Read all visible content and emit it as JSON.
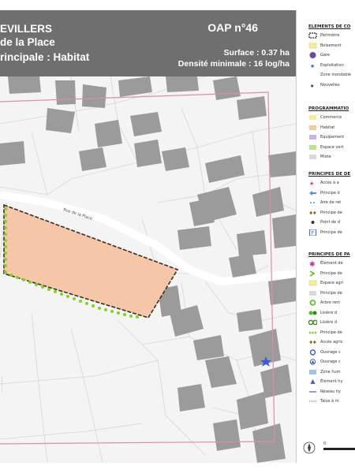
{
  "header": {
    "line1": "EVILLERS",
    "line2": "de la Place",
    "line3": "rincipale : Habitat",
    "oap": "OAP n°46",
    "surface": "Surface : 0.37 ha",
    "densite": "Densité minimale : 16 log/ha"
  },
  "map": {
    "street_label": "Rue de la Place",
    "vertical_note": "..............."
  },
  "legend": {
    "sections": [
      {
        "title": "ELEMENTS DE CO",
        "items": [
          {
            "icon": "perimeter-dashed-icon",
            "label": "Périmètre"
          },
          {
            "icon": "yellow-box-icon",
            "label": "Boisement"
          },
          {
            "icon": "purple-circle-icon",
            "label": "Gare"
          },
          {
            "icon": "blue-star-icon",
            "label": "Exploitation"
          },
          {
            "icon": "empty-icon",
            "label": "Zone inondable"
          },
          {
            "icon": "black-star-icon",
            "label": "Nouvelles"
          }
        ]
      },
      {
        "title": "PROGRAMMATIO",
        "items": [
          {
            "icon": "yellow-swatch-icon",
            "label": "Commerce"
          },
          {
            "icon": "orange-swatch-icon",
            "label": "Habitat"
          },
          {
            "icon": "purple-swatch-icon",
            "label": "Equipement"
          },
          {
            "icon": "green-swatch-icon",
            "label": "Espace vert"
          },
          {
            "icon": "gray-swatch-icon",
            "label": "Mixte"
          }
        ]
      },
      {
        "title": "PRINCIPES DE DE",
        "items": [
          {
            "icon": "red-star-icon",
            "label": "Accès à a"
          },
          {
            "icon": "blue-arrow-icon",
            "label": "Principe d"
          },
          {
            "icon": "blue-dotted-icon",
            "label": "Aire de ret"
          },
          {
            "icon": "brown-double-arrow-icon",
            "label": "Principe de"
          },
          {
            "icon": "point-icon",
            "label": "Point de d"
          },
          {
            "icon": "parking-icon",
            "label": "Principe de"
          }
        ]
      },
      {
        "title": "PRINCIPES DE PA",
        "items": [
          {
            "icon": "magenta-asterisk-icon",
            "label": "Élément de"
          },
          {
            "icon": "green-chevron-icon",
            "label": "Principe de"
          },
          {
            "icon": "yellow-box-icon",
            "label": "Espace agri"
          },
          {
            "icon": "gray-swatch-icon",
            "label": "Principe de"
          },
          {
            "icon": "green-ring-icon",
            "label": "Arbre rem"
          },
          {
            "icon": "green-balls-icon",
            "label": "Lisière d"
          },
          {
            "icon": "green-double-ring-icon",
            "label": "Lisière d"
          },
          {
            "icon": "green-dots-icon",
            "label": "Principe de"
          },
          {
            "icon": "brown-double-arrow-icon",
            "label": "Accès agric"
          },
          {
            "icon": "blue-circle-icon",
            "label": "Ouvrage c"
          },
          {
            "icon": "blue-triangle-icon",
            "label": "Ouvrage c"
          },
          {
            "icon": "blue-swatch-icon",
            "label": "Zone hum"
          },
          {
            "icon": "blue-triangle-small-icon",
            "label": "Élément hy"
          },
          {
            "icon": "blue-line-icon",
            "label": "Réseau hy"
          },
          {
            "icon": "talus-icon",
            "label": "Talus à m"
          }
        ]
      }
    ],
    "scale_label": "0"
  }
}
